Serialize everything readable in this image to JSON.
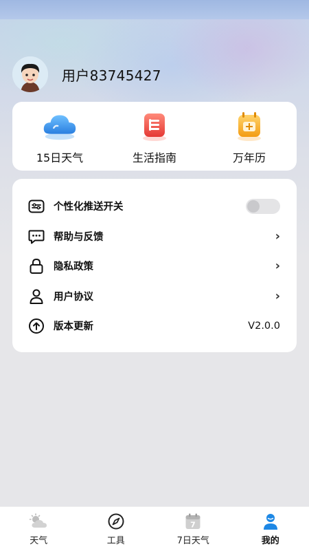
{
  "user": {
    "name": "用户83745427"
  },
  "quick_actions": [
    {
      "label": "15日天气",
      "icon": "cloud-icon"
    },
    {
      "label": "生活指南",
      "icon": "guide-icon"
    },
    {
      "label": "万年历",
      "icon": "calendar-icon"
    }
  ],
  "settings": [
    {
      "label": "个性化推送开关",
      "icon": "push-toggle-icon",
      "right": "toggle",
      "toggle_on": false
    },
    {
      "label": "帮助与反馈",
      "icon": "chat-icon",
      "right": "chevron"
    },
    {
      "label": "隐私政策",
      "icon": "lock-icon",
      "right": "chevron"
    },
    {
      "label": "用户协议",
      "icon": "user-icon",
      "right": "chevron"
    },
    {
      "label": "版本更新",
      "icon": "update-icon",
      "right": "text",
      "value": "V2.0.0"
    }
  ],
  "nav": [
    {
      "label": "天气",
      "icon": "weather-icon",
      "active": false
    },
    {
      "label": "工具",
      "icon": "compass-icon",
      "active": false
    },
    {
      "label": "7日天气",
      "icon": "calendar-7-icon",
      "active": false
    },
    {
      "label": "我的",
      "icon": "profile-icon",
      "active": true
    }
  ],
  "colors": {
    "accent": "#1e88e5",
    "card": "#ffffff",
    "text": "#111111"
  },
  "calendar_badge": "7"
}
